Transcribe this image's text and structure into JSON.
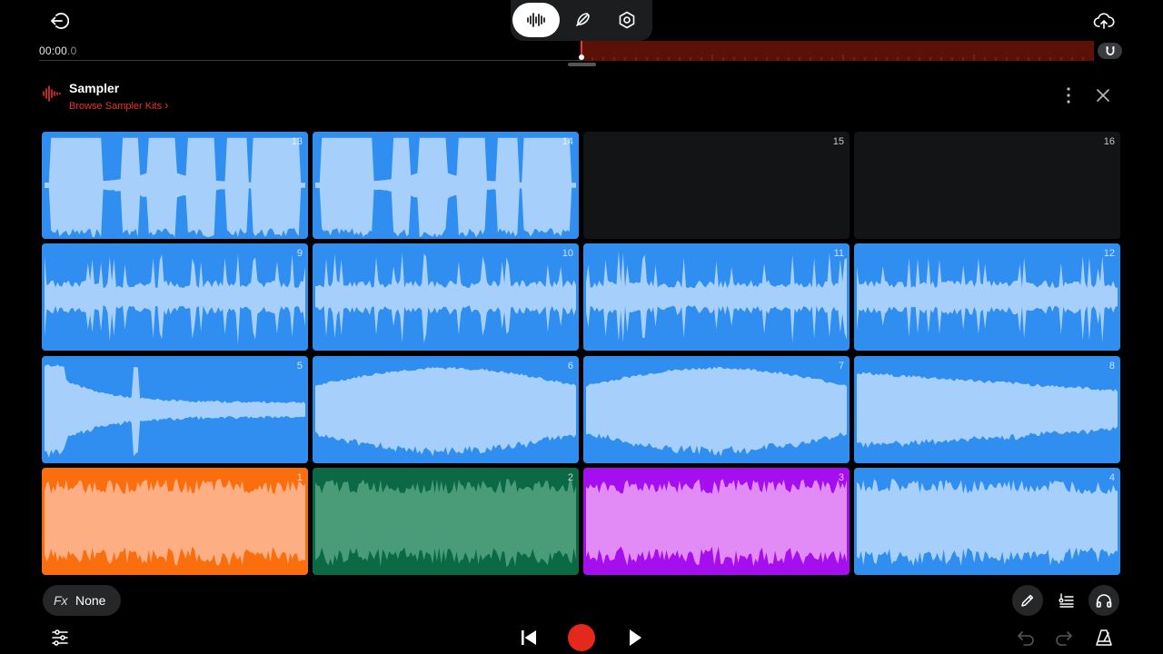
{
  "time": {
    "main": "00:00",
    "fraction": ".0"
  },
  "header": {
    "title": "Sampler",
    "browse_link": "Browse Sampler Kits",
    "browse_chevron": "›"
  },
  "fx": {
    "label": "Fx",
    "value": "None"
  },
  "colors": {
    "blue_bg": "#2f8ef0",
    "blue_wave": "#a6d0fb",
    "orange_bg": "#fa6e0e",
    "orange_wave": "#fdae82",
    "green_bg": "#0b6a45",
    "green_wave": "#4a9b78",
    "purple_bg": "#a50ff0",
    "purple_wave": "#e28bf7",
    "empty_bg": "#121415",
    "accent_red": "#e8352b"
  },
  "pads": [
    {
      "number": "13",
      "color": "blue",
      "wave": "burst"
    },
    {
      "number": "14",
      "color": "blue",
      "wave": "burst"
    },
    {
      "number": "15",
      "color": "empty",
      "wave": "none"
    },
    {
      "number": "16",
      "color": "empty",
      "wave": "none"
    },
    {
      "number": "9",
      "color": "blue",
      "wave": "spiky"
    },
    {
      "number": "10",
      "color": "blue",
      "wave": "spiky"
    },
    {
      "number": "11",
      "color": "blue",
      "wave": "spiky"
    },
    {
      "number": "12",
      "color": "blue",
      "wave": "spiky"
    },
    {
      "number": "5",
      "color": "blue",
      "wave": "decay"
    },
    {
      "number": "6",
      "color": "blue",
      "wave": "swell"
    },
    {
      "number": "7",
      "color": "blue",
      "wave": "swell"
    },
    {
      "number": "8",
      "color": "blue",
      "wave": "fade"
    },
    {
      "number": "1",
      "color": "orange",
      "wave": "dense"
    },
    {
      "number": "2",
      "color": "green",
      "wave": "dense"
    },
    {
      "number": "3",
      "color": "purple",
      "wave": "dense"
    },
    {
      "number": "4",
      "color": "blue",
      "wave": "dense"
    }
  ],
  "icons": {
    "back": "exit-arrow-icon",
    "wave_mode": "waveform-icon",
    "pen_mode": "feather-pen-icon",
    "settings_mode": "hexagon-settings-icon",
    "upload": "cloud-upload-icon",
    "magnet": "magnet-icon",
    "more": "vertical-dots-icon",
    "close": "close-icon",
    "pencil": "pencil-icon",
    "notes": "notes-icon",
    "headphones": "headphones-icon",
    "mixer": "sliders-icon",
    "skip_back": "skip-back-icon",
    "record": "record-icon",
    "play": "play-icon",
    "undo": "undo-icon",
    "redo": "redo-icon",
    "metronome": "metronome-icon"
  }
}
